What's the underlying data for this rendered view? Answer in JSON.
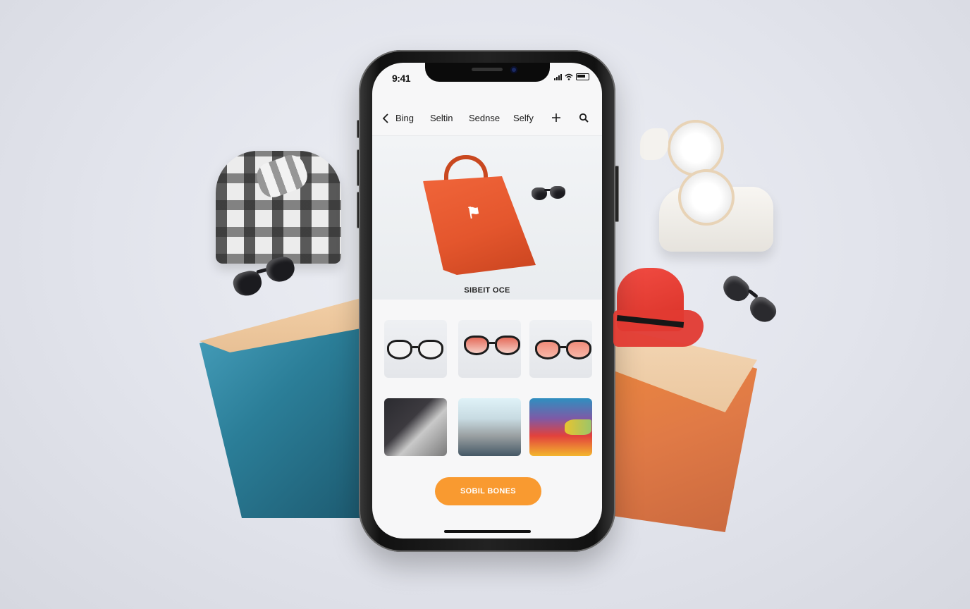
{
  "status_bar": {
    "time": "9:41",
    "icons": [
      "signal-icon",
      "wifi-icon",
      "battery-icon"
    ]
  },
  "nav": {
    "back_icon": "chevron-left-icon",
    "items": [
      "Bing",
      "Seltin",
      "Sednse",
      "Selfy"
    ],
    "add_icon": "plus-icon",
    "search_icon": "search-icon"
  },
  "hero": {
    "product": "orange shopping bag",
    "caption": "SIBEIT OCE"
  },
  "grid": {
    "tiles": [
      {
        "label": "clear-frame glasses"
      },
      {
        "label": "red-tint sunglasses"
      },
      {
        "label": "orange-tint sunglasses"
      },
      {
        "label": "silver sneaker"
      },
      {
        "label": "silver bag"
      },
      {
        "label": "gradient abstract"
      }
    ]
  },
  "cta": {
    "label": "SOBIL BONES"
  },
  "colors": {
    "accent": "#f99a30",
    "bag": "#e4562d",
    "background": "#e4e6ec"
  }
}
